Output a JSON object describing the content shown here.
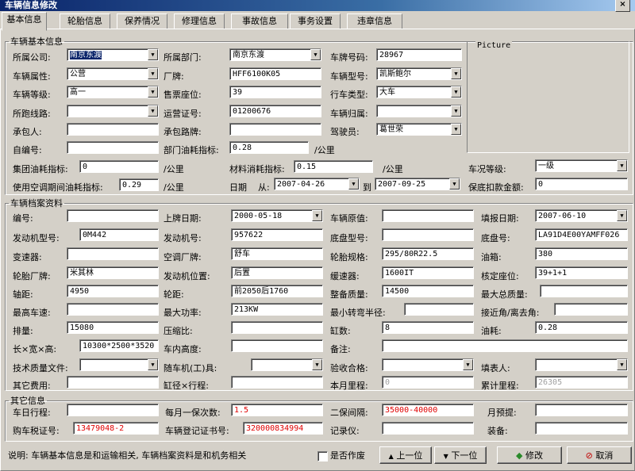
{
  "window": {
    "title": "车辆信息修改",
    "close": "×"
  },
  "tabs": [
    "基本信息",
    "轮胎信息",
    "保养情况",
    "修理信息",
    "事故信息",
    "事务设置",
    "违章信息"
  ],
  "basic": {
    "legend": "车辆基本信息",
    "picture_label": "Picture",
    "suffix_unit": "/公里",
    "labels": {
      "company": "所属公司:",
      "dept": "所属部门:",
      "plate": "车牌号码:",
      "property": "车辆属性:",
      "brand": "厂牌:",
      "model": "车辆型号:",
      "grade": "车辆等级:",
      "seats": "售票座位:",
      "vtype": "行车类型:",
      "route": "所跑线路:",
      "permit": "运营证号:",
      "belong": "车辆归属:",
      "contractor": "承包人:",
      "contract_route": "承包路牌:",
      "driver": "驾驶员:",
      "selfno": "自编号:",
      "dept_fuel": "部门油耗指标:",
      "group_fuel": "集团油耗指标:",
      "material": "材料消耗指标:",
      "condition": "车况等级:",
      "ac_fuel": "使用空调期间油耗指标:",
      "date": "日期",
      "from": "从:",
      "to": "到",
      "deduct": "保底扣款金额:"
    },
    "values": {
      "company": "南京东渡",
      "dept": "南京东渡",
      "plate": "28967",
      "property": "公营",
      "brand": "HFF6100K05",
      "model": "凯斯鲍尔",
      "grade": "高一",
      "seats": "39",
      "vtype": "大车",
      "route": "",
      "permit": "01200676",
      "belong": "",
      "contractor": "",
      "contract_route": "",
      "driver": "葛世荣",
      "selfno": "",
      "dept_fuel": "0.28",
      "group_fuel": "0",
      "material": "0.15",
      "condition": "一级",
      "ac_fuel": "0.29",
      "date_from": "2007-04-26",
      "date_to": "2007-09-25",
      "deduct": "0"
    }
  },
  "archive": {
    "legend": "车辆档案资料",
    "labels": {
      "num": "编号:",
      "reg_date": "上牌日期:",
      "orig_value": "车辆原值:",
      "fill_date": "填报日期:",
      "engine_model": "发动机型号:",
      "engine_no": "发动机号:",
      "chassis_model": "底盘型号:",
      "chassis_no": "底盘号:",
      "gearbox": "变速器:",
      "ac_brand": "空调厂牌:",
      "tire_spec": "轮胎规格:",
      "tank": "油箱:",
      "tire_brand": "轮胎厂牌:",
      "engine_pos": "发动机位置:",
      "retarder": "缓速器:",
      "rated_seats": "核定座位:",
      "wheelbase": "轴距:",
      "track": "轮距:",
      "curb_weight": "整备质量:",
      "max_total": "最大总质量:",
      "max_speed": "最高车速:",
      "max_power": "最大功率:",
      "min_turn": "最小转弯半径:",
      "approach": "接近角/离去角:",
      "displacement": "排量:",
      "compression": "压缩比:",
      "gears": "缸数:",
      "fuel": "油耗:",
      "dims": "长×宽×高:",
      "inner_height": "车内高度:",
      "remark": "备注:",
      "tech_doc": "技术质量文件:",
      "tools": "随车机(工)具:",
      "acceptance": "验收合格:",
      "filler": "填表人:",
      "other_cost": "其它费用:",
      "cyl_stroke": "缸径×行程:",
      "month_mileage": "本月里程:",
      "total_mileage": "累计里程:"
    },
    "values": {
      "num": "",
      "reg_date": "2000-05-18",
      "orig_value": "",
      "fill_date": "2007-06-10",
      "engine_model": "0M442",
      "engine_no": "957622",
      "chassis_model": "",
      "chassis_no": "LA91D4E00YAMFF026",
      "gearbox": "",
      "ac_brand": "舒车",
      "tire_spec": "295/80R22.5",
      "tank": "380",
      "tire_brand": "米其林",
      "engine_pos": "后置",
      "retarder": "1600IT",
      "rated_seats": "39+1+1",
      "wheelbase": "4950",
      "track": "前2050后1760",
      "curb_weight": "14500",
      "max_total": "",
      "max_speed": "",
      "max_power": "213KW",
      "min_turn": "",
      "approach": "",
      "displacement": "15080",
      "compression": "",
      "gears": "8",
      "fuel": "0.28",
      "dims": "10300*2500*3520",
      "inner_height": "",
      "remark": "",
      "tech_doc": "",
      "tools": "",
      "acceptance": "",
      "filler": "",
      "other_cost": "",
      "cyl_stroke": "",
      "month_mileage": "0",
      "total_mileage": "26305"
    }
  },
  "other": {
    "legend": "其它信息",
    "labels": {
      "daily": "车日行程:",
      "monthly_maint": "每月一保次数:",
      "second_maint": "二保间隔:",
      "month_budget": "月预提:",
      "tax_no": "购车税证号:",
      "reg_cert": "车辆登记证书号:",
      "record": "记录仪:",
      "equip": "装备:"
    },
    "values": {
      "daily": "",
      "monthly_maint": "1.5",
      "second_maint": "35000-40000",
      "month_budget": "",
      "tax_no": "13479048-2",
      "reg_cert": "320000834994",
      "record": "",
      "equip": ""
    }
  },
  "footer": {
    "note": "说明: 车辆基本信息是和运输相关, 车辆档案资料是和机务相关",
    "obsolete": "是否作废",
    "prev": "上一位",
    "next": "下一位",
    "modify": "修改",
    "cancel": "取消"
  }
}
